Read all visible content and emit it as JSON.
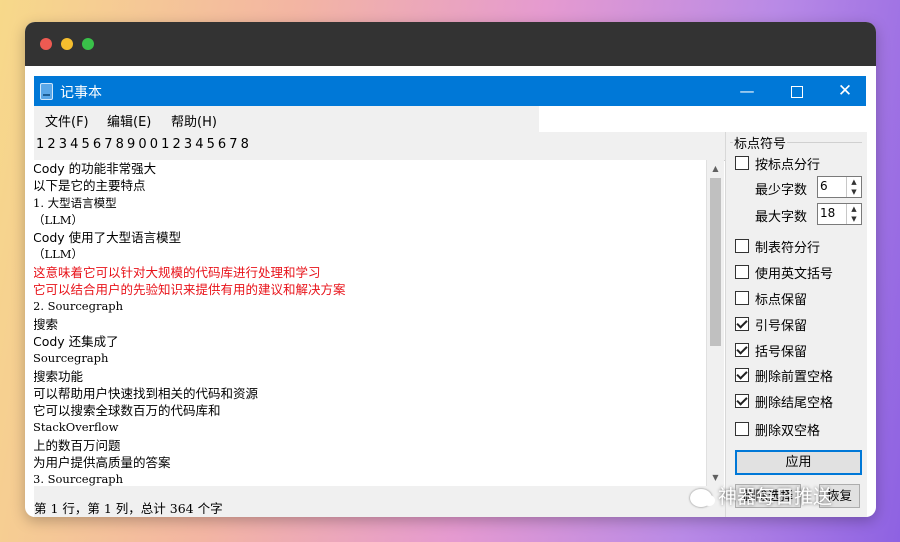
{
  "window": {
    "title": "记事本",
    "controls": {
      "minimize": "—",
      "close": "✕"
    }
  },
  "menu": [
    {
      "label": "文件(F)"
    },
    {
      "label": "编辑(E)"
    },
    {
      "label": "帮助(H)"
    }
  ],
  "ruler": "1234567890012345678",
  "editor": {
    "lines": [
      {
        "text": "Cody 的功能非常强大",
        "color": "normal"
      },
      {
        "text": "以下是它的主要特点",
        "color": "normal"
      },
      {
        "text": "1. 大型语言模型",
        "color": "normal"
      },
      {
        "text": "（LLM）",
        "color": "normal"
      },
      {
        "text": "Cody 使用了大型语言模型",
        "color": "normal"
      },
      {
        "text": "（LLM）",
        "color": "normal"
      },
      {
        "text": "这意味着它可以针对大规模的代码库进行处理和学习",
        "color": "red"
      },
      {
        "text": "它可以结合用户的先验知识来提供有用的建议和解决方案",
        "color": "red"
      },
      {
        "text": "2. Sourcegraph",
        "color": "normal"
      },
      {
        "text": "搜索",
        "color": "normal"
      },
      {
        "text": "Cody 还集成了",
        "color": "normal"
      },
      {
        "text": "Sourcegraph",
        "color": "normal"
      },
      {
        "text": "搜索功能",
        "color": "normal"
      },
      {
        "text": "可以帮助用户快速找到相关的代码和资源",
        "color": "normal"
      },
      {
        "text": "它可以搜索全球数百万的代码库和",
        "color": "normal"
      },
      {
        "text": "StackOverflow",
        "color": "normal"
      },
      {
        "text": "上的数百万问题",
        "color": "normal"
      },
      {
        "text": "为用户提供高质量的答案",
        "color": "normal"
      },
      {
        "text": "3. Sourcegraph",
        "color": "normal"
      }
    ]
  },
  "status": "第 1 行，第 1 列，总计 364 个字",
  "panel": {
    "group_title": "标点符号",
    "split_by_punct": {
      "label": "按标点分行",
      "checked": false
    },
    "min_chars": {
      "label": "最少字数",
      "value": "6"
    },
    "max_chars": {
      "label": "最大字数",
      "value": "18"
    },
    "options": [
      {
        "label": "制表符分行",
        "checked": false
      },
      {
        "label": "使用英文括号",
        "checked": false
      },
      {
        "label": "标点保留",
        "checked": false
      },
      {
        "label": "引号保留",
        "checked": true
      },
      {
        "label": "括号保留",
        "checked": true
      },
      {
        "label": "删除前置空格",
        "checked": true
      },
      {
        "label": "删除结尾空格",
        "checked": true
      },
      {
        "label": "删除双空格",
        "checked": false
      }
    ],
    "apply_label": "应用",
    "delete_selection_label": "删除选择",
    "restore_label": "恢复"
  },
  "watermark": "神器每日推送"
}
